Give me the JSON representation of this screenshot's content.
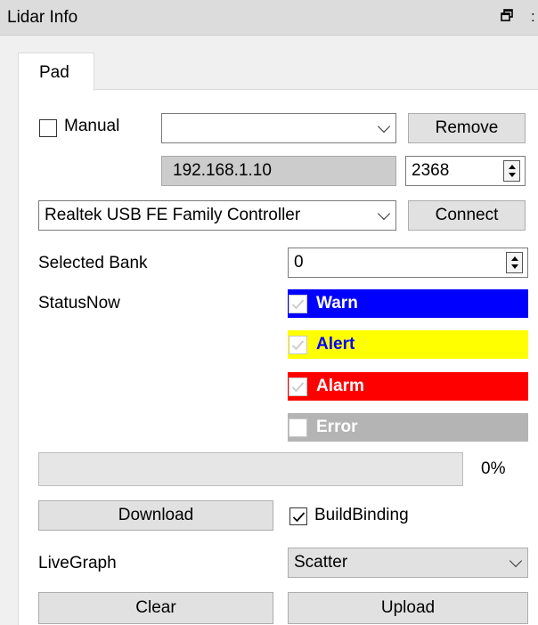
{
  "window": {
    "title": "Lidar Info",
    "float_icon": "restore-window-icon",
    "close_fragment": ":"
  },
  "tabs": [
    {
      "label": "Pad",
      "active": true
    }
  ],
  "connection": {
    "manual_label": "Manual",
    "manual_checked": false,
    "device_select_value": "",
    "remove_label": "Remove",
    "ip_value": "192.168.1.10",
    "port_value": "2368",
    "adapter_value": "Realtek USB FE Family Controller",
    "connect_label": "Connect"
  },
  "bank": {
    "label": "Selected Bank",
    "value": "0"
  },
  "status": {
    "label": "StatusNow",
    "items": [
      {
        "label": "Warn",
        "checked": true,
        "bg": "#0000ff",
        "fg": "#ffffff"
      },
      {
        "label": "Alert",
        "checked": true,
        "bg": "#ffff00",
        "fg": "#0000ff"
      },
      {
        "label": "Alarm",
        "checked": true,
        "bg": "#ff0000",
        "fg": "#ffffff"
      },
      {
        "label": "Error",
        "checked": false,
        "bg": "#b4b4b4",
        "fg": "#ffffff"
      }
    ]
  },
  "progress": {
    "value_pct": 0,
    "text": "0%"
  },
  "download": {
    "label": "Download"
  },
  "build_binding": {
    "label": "BuildBinding",
    "checked": true
  },
  "live_graph": {
    "label": "LiveGraph",
    "value": "Scatter"
  },
  "actions": {
    "clear_label": "Clear",
    "upload_label": "Upload"
  }
}
